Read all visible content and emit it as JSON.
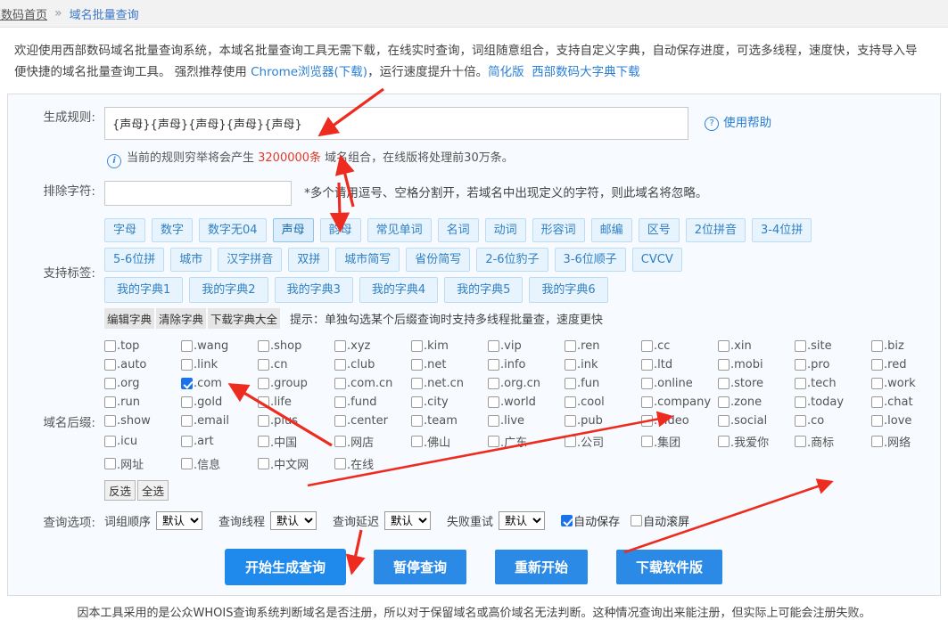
{
  "breadcrumb": {
    "home": "部数码首页",
    "separator": "»",
    "current": "域名批量查询"
  },
  "intro": {
    "line1": "欢迎使用西部数码域名批量查询系统，本域名批量查询工具无需下载，在线实时查询，词组随意组合，支持自定义字典，自动保存进度，可选多线程，速度快，支持导入导",
    "line2_a": "便快捷的域名批量查询工具。 强烈推荐使用 ",
    "line2_link1": "Chrome浏览器(下载)",
    "line2_b": "，运行速度提升十倍。",
    "line2_link2": "简化版",
    "line2_link3": "西部数码大字典下载"
  },
  "form": {
    "rule_label": "生成规则:",
    "rule_value": "{声母}{声母}{声母}{声母}{声母}",
    "rule_placeholder": "",
    "help_link": "使用帮助",
    "help_icon": "question-circle-icon",
    "note_icon": "info-circle-icon",
    "note_prefix": "当前的规则穷举将会产生 ",
    "note_count": "3200000条",
    "note_suffix": " 域名组合，在线版将处理前30万条。",
    "exclude_label": "排除字符:",
    "exclude_value": "",
    "exclude_hint": "*多个请用逗号、空格分割开，若域名中出现定义的字符，则此域名将忽略。",
    "tags_label": "支持标签:",
    "suffix_label": "域名后缀:",
    "options_label": "查询选项:"
  },
  "tags": {
    "row1": [
      {
        "label": "字母",
        "selected": false
      },
      {
        "label": "数字",
        "selected": false
      },
      {
        "label": "数字无04",
        "selected": false
      },
      {
        "label": "声母",
        "selected": true
      },
      {
        "label": "韵母",
        "selected": false
      },
      {
        "label": "常见单词",
        "selected": false
      },
      {
        "label": "名词",
        "selected": false
      },
      {
        "label": "动词",
        "selected": false
      },
      {
        "label": "形容词",
        "selected": false
      },
      {
        "label": "邮编",
        "selected": false
      },
      {
        "label": "区号",
        "selected": false
      },
      {
        "label": "2位拼音",
        "selected": false
      },
      {
        "label": "3-4位拼",
        "selected": false
      }
    ],
    "row2": [
      {
        "label": "5-6位拼",
        "selected": false
      },
      {
        "label": "城市",
        "selected": false
      },
      {
        "label": "汉字拼音",
        "selected": false
      },
      {
        "label": "双拼",
        "selected": false
      },
      {
        "label": "城市简写",
        "selected": false
      },
      {
        "label": "省份简写",
        "selected": false
      },
      {
        "label": "2-6位豹子",
        "selected": false
      },
      {
        "label": "3-6位顺子",
        "selected": false
      },
      {
        "label": "CVCV",
        "selected": false
      }
    ],
    "dictionaries": [
      {
        "label": "我的字典1"
      },
      {
        "label": "我的字典2"
      },
      {
        "label": "我的字典3"
      },
      {
        "label": "我的字典4"
      },
      {
        "label": "我的字典5"
      },
      {
        "label": "我的字典6"
      }
    ],
    "mini_buttons": [
      {
        "label": "编辑字典"
      },
      {
        "label": "清除字典"
      },
      {
        "label": "下载字典大全"
      }
    ],
    "tip": "提示：单独勾选某个后缀查询时支持多线程批量查，速度更快"
  },
  "suffixes": [
    {
      "label": ".top",
      "checked": false
    },
    {
      "label": ".wang",
      "checked": false
    },
    {
      "label": ".shop",
      "checked": false
    },
    {
      "label": ".xyz",
      "checked": false
    },
    {
      "label": ".kim",
      "checked": false
    },
    {
      "label": ".vip",
      "checked": false
    },
    {
      "label": ".ren",
      "checked": false
    },
    {
      "label": ".cc",
      "checked": false
    },
    {
      "label": ".xin",
      "checked": false
    },
    {
      "label": ".site",
      "checked": false
    },
    {
      "label": ".biz",
      "checked": false
    },
    {
      "label": ".auto",
      "checked": false
    },
    {
      "label": ".link",
      "checked": false
    },
    {
      "label": ".cn",
      "checked": false
    },
    {
      "label": ".club",
      "checked": false
    },
    {
      "label": ".net",
      "checked": false
    },
    {
      "label": ".info",
      "checked": false
    },
    {
      "label": ".ink",
      "checked": false
    },
    {
      "label": ".ltd",
      "checked": false
    },
    {
      "label": ".mobi",
      "checked": false
    },
    {
      "label": ".pro",
      "checked": false
    },
    {
      "label": ".red",
      "checked": false
    },
    {
      "label": ".org",
      "checked": false
    },
    {
      "label": ".com",
      "checked": true
    },
    {
      "label": ".group",
      "checked": false
    },
    {
      "label": ".com.cn",
      "checked": false
    },
    {
      "label": ".net.cn",
      "checked": false
    },
    {
      "label": ".org.cn",
      "checked": false
    },
    {
      "label": ".fun",
      "checked": false
    },
    {
      "label": ".online",
      "checked": false
    },
    {
      "label": ".store",
      "checked": false
    },
    {
      "label": ".tech",
      "checked": false
    },
    {
      "label": ".work",
      "checked": false
    },
    {
      "label": ".run",
      "checked": false
    },
    {
      "label": ".gold",
      "checked": false
    },
    {
      "label": ".life",
      "checked": false
    },
    {
      "label": ".fund",
      "checked": false
    },
    {
      "label": ".city",
      "checked": false
    },
    {
      "label": ".world",
      "checked": false
    },
    {
      "label": ".cool",
      "checked": false
    },
    {
      "label": ".company",
      "checked": false
    },
    {
      "label": ".zone",
      "checked": false
    },
    {
      "label": ".today",
      "checked": false
    },
    {
      "label": ".chat",
      "checked": false
    },
    {
      "label": ".show",
      "checked": false
    },
    {
      "label": ".email",
      "checked": false
    },
    {
      "label": ".plus",
      "checked": false
    },
    {
      "label": ".center",
      "checked": false
    },
    {
      "label": ".team",
      "checked": false
    },
    {
      "label": ".live",
      "checked": false
    },
    {
      "label": ".pub",
      "checked": false
    },
    {
      "label": ".video",
      "checked": false
    },
    {
      "label": ".social",
      "checked": false
    },
    {
      "label": ".co",
      "checked": false
    },
    {
      "label": ".love",
      "checked": false
    },
    {
      "label": ".icu",
      "checked": false
    },
    {
      "label": ".art",
      "checked": false
    },
    {
      "label": ".中国",
      "checked": false
    },
    {
      "label": ".网店",
      "checked": false
    },
    {
      "label": ".佛山",
      "checked": false
    },
    {
      "label": ".广东",
      "checked": false
    },
    {
      "label": ".公司",
      "checked": false
    },
    {
      "label": ".集团",
      "checked": false
    },
    {
      "label": ".我爱你",
      "checked": false
    },
    {
      "label": ".商标",
      "checked": false
    },
    {
      "label": ".网络",
      "checked": false
    },
    {
      "label": ".网址",
      "checked": false
    },
    {
      "label": ".信息",
      "checked": false
    },
    {
      "label": ".中文网",
      "checked": false
    },
    {
      "label": ".在线",
      "checked": false
    }
  ],
  "select_buttons": [
    {
      "label": "反选"
    },
    {
      "label": "全选"
    }
  ],
  "query_options": {
    "items": [
      {
        "label": "词组顺序",
        "value": "默认"
      },
      {
        "label": "查询线程",
        "value": "默认"
      },
      {
        "label": "查询延迟",
        "value": "默认"
      },
      {
        "label": "失败重试",
        "value": "默认"
      }
    ],
    "checkboxes": [
      {
        "label": "自动保存",
        "checked": true
      },
      {
        "label": "自动滚屏",
        "checked": false
      }
    ]
  },
  "action_buttons": [
    {
      "label": "开始生成查询",
      "primary": true
    },
    {
      "label": "暂停查询",
      "primary": false
    },
    {
      "label": "重新开始",
      "primary": false
    },
    {
      "label": "下载软件版",
      "primary": false
    }
  ],
  "footer": "因本工具采用的是公众WHOIS查询系统判断域名是否注册，所以对于保留域名或高价域名无法判断。这种情况查询出来能注册，但实际上可能会注册失败。",
  "colors": {
    "accent": "#2b8ae6",
    "link": "#2b7fd4",
    "panel_bg": "#f7fbff",
    "tag_bg": "#e8f4fd",
    "red": "#e23b27",
    "annotation_arrow": "#ee2b1f"
  }
}
